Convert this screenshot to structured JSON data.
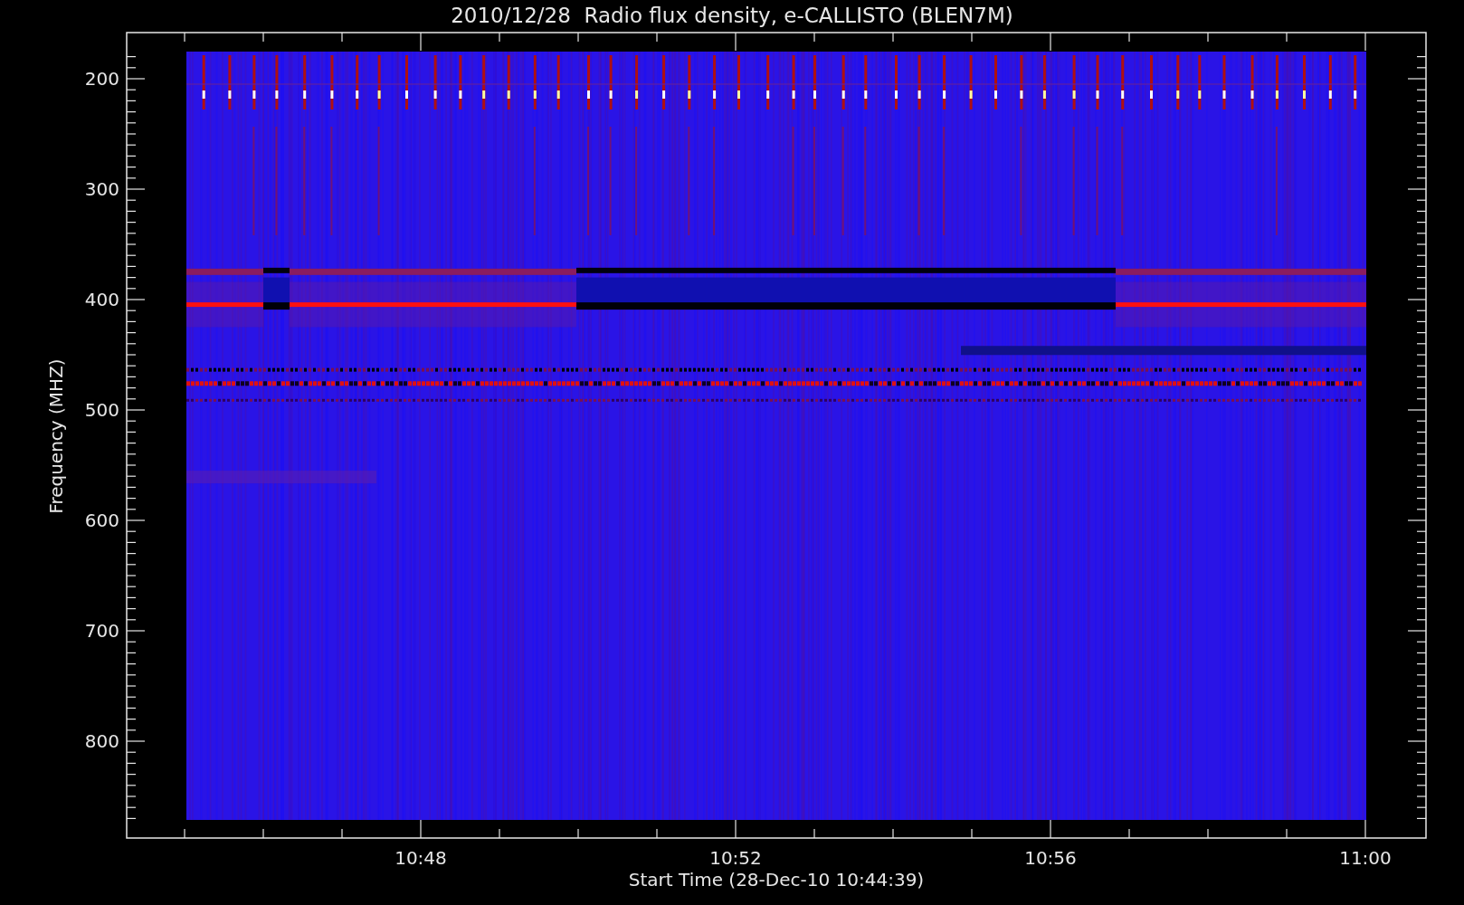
{
  "plot": {
    "title": "2010/12/28  Radio flux density, e-CALLISTO (BLEN7M)",
    "xlabel": "Start Time (28-Dec-10 10:44:39)",
    "ylabel": "Frequency (MHZ)",
    "y_tick_labels": [
      "200",
      "300",
      "400",
      "500",
      "600",
      "700",
      "800"
    ],
    "x_tick_labels": [
      "10:48",
      "10:52",
      "10:56",
      "11:00"
    ]
  }
}
